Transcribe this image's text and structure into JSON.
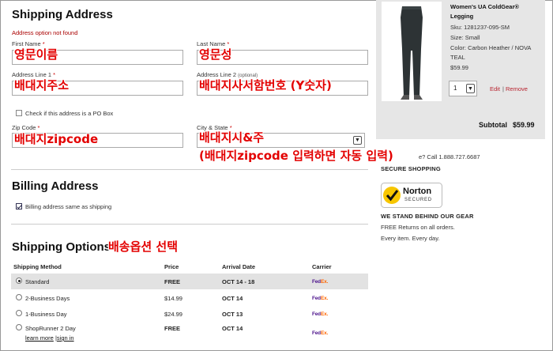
{
  "shipping": {
    "title": "Shipping Address",
    "error": "Address option not found",
    "first_name_label": "First Name",
    "last_name_label": "Last Name",
    "address1_label": "Address Line 1",
    "address2_label": "Address Line 2",
    "address2_optional": "(optional)",
    "po_box_label": "Check if this address is a PO Box",
    "zip_label": "Zip Code",
    "city_state_label": "City & State",
    "required_mark": "*"
  },
  "annotations": {
    "first_name": "영문이름",
    "last_name": "영문성",
    "address1": "배대지주소",
    "address2": "배대지사서함번호 (Y숫자)",
    "zip": "배대지zipcode",
    "city_state_1": "배대지시&주",
    "city_state_2": "(배대지zipcode 입력하면 자동 입력)",
    "shipping_options": "배송옵션 선택"
  },
  "billing": {
    "title": "Billing Address",
    "same_label": "Billing address same as shipping"
  },
  "options": {
    "title": "Shipping Options",
    "headers": [
      "Shipping Method",
      "Price",
      "Arrival Date",
      "Carrier"
    ],
    "rows": [
      {
        "method": "Standard",
        "price": "FREE",
        "arrival": "OCT 14 - 18"
      },
      {
        "method": "2-Business Days",
        "price": "$14.99",
        "arrival": "OCT 14"
      },
      {
        "method": "1-Business Day",
        "price": "$24.99",
        "arrival": "OCT 13"
      },
      {
        "method": "ShopRunner 2 Day",
        "price": "FREE",
        "arrival": "OCT 14"
      }
    ],
    "learn_more": "learn more",
    "separator": "|",
    "sign_in": "sign in",
    "carrier_fed": "Fed",
    "carrier_ex": "Ex."
  },
  "cart": {
    "product_name": "Women's UA ColdGear® Legging",
    "sku": "Sku: 1281237-095-SM",
    "size": "Size: Small",
    "color": "Color: Carbon Heather / NOVA TEAL",
    "price": "$59.99",
    "qty": "1",
    "edit": "Edit",
    "pipe": "|",
    "remove": "Remove",
    "subtotal_label": "Subtotal",
    "subtotal_value": "$59.99"
  },
  "sidebar": {
    "call": "e? Call 1.888.727.6687",
    "secure": "SECURE SHOPPING",
    "norton_name": "Norton",
    "norton_secured": "SECURED",
    "stand_behind": "WE STAND BEHIND OUR GEAR",
    "free_returns": "FREE Returns on all orders.",
    "every_item": "Every item. Every day."
  },
  "colors": {
    "annotation": "#e30000",
    "link": "#b8232f",
    "fedex_purple": "#4d148c",
    "fedex_orange": "#ff6600",
    "norton_yellow": "#f7c600"
  }
}
